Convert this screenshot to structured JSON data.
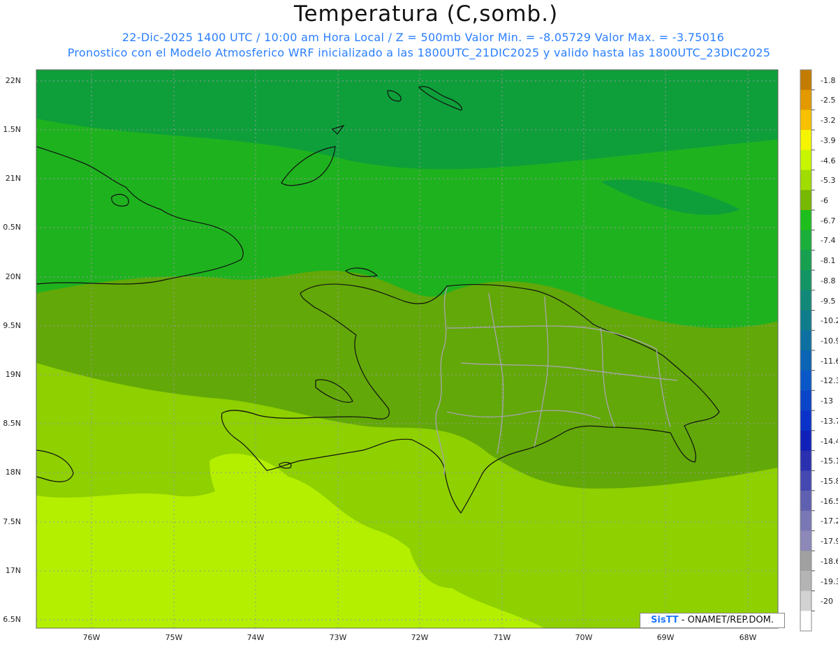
{
  "title": "Temperatura (C,somb.)",
  "subtitle_line1": "22-Dic-2025  1400 UTC / 10:00 am Hora Local / Z = 500mb  Valor Min. = -8.05729  Valor Max. = -3.75016",
  "subtitle_line2": "Pronostico con el Modelo Atmosferico WRF inicializado a las 1800UTC_21DIC2025 y valido hasta las  1800UTC_23DIC2025",
  "lat_labels": [
    "22N",
    "1.5N",
    "21N",
    "0.5N",
    "20N",
    "9.5N",
    "19N",
    "8.5N",
    "18N",
    "7.5N",
    "17N",
    "6.5N"
  ],
  "lon_labels": [
    "76W",
    "75W",
    "74W",
    "73W",
    "72W",
    "71W",
    "70W",
    "69W",
    "68W"
  ],
  "colorbar": {
    "labels": [
      "-1.8",
      "-2.5",
      "-3.2",
      "-3.9",
      "-4.6",
      "-5.3",
      "-6",
      "-6.7",
      "-7.4",
      "-8.1",
      "-8.8",
      "-9.5",
      "-10.2",
      "-10.9",
      "-11.6",
      "-12.3",
      "-13",
      "-13.7",
      "-14.4",
      "-15.1",
      "-15.8",
      "-16.5",
      "-17.2",
      "-17.9",
      "-18.6",
      "-19.3",
      "-20"
    ],
    "colors": [
      "#c47c00",
      "#e39a00",
      "#f7c000",
      "#f5f500",
      "#c8f500",
      "#a0dc00",
      "#78b800",
      "#1ebe1e",
      "#1aae3a",
      "#16a050",
      "#139464",
      "#118878",
      "#0f7c8c",
      "#0d70a0",
      "#0b64b4",
      "#0a58c8",
      "#0a44c8",
      "#0a32c8",
      "#1020b8",
      "#2a30b0",
      "#4448b0",
      "#6060b0",
      "#7a78b4",
      "#8c88b8",
      "#a0a0a0",
      "#b4b4b4",
      "#d2d2d2",
      "#ffffff"
    ]
  },
  "field_colors": {
    "north": "#0e9f3a",
    "mid": "#1fb21f",
    "central": "#62a808",
    "south": "#8ed000",
    "far_south": "#b4ef00"
  },
  "credit": {
    "logo": "SisTT",
    "text": " - ONAMET/REP.DOM."
  }
}
